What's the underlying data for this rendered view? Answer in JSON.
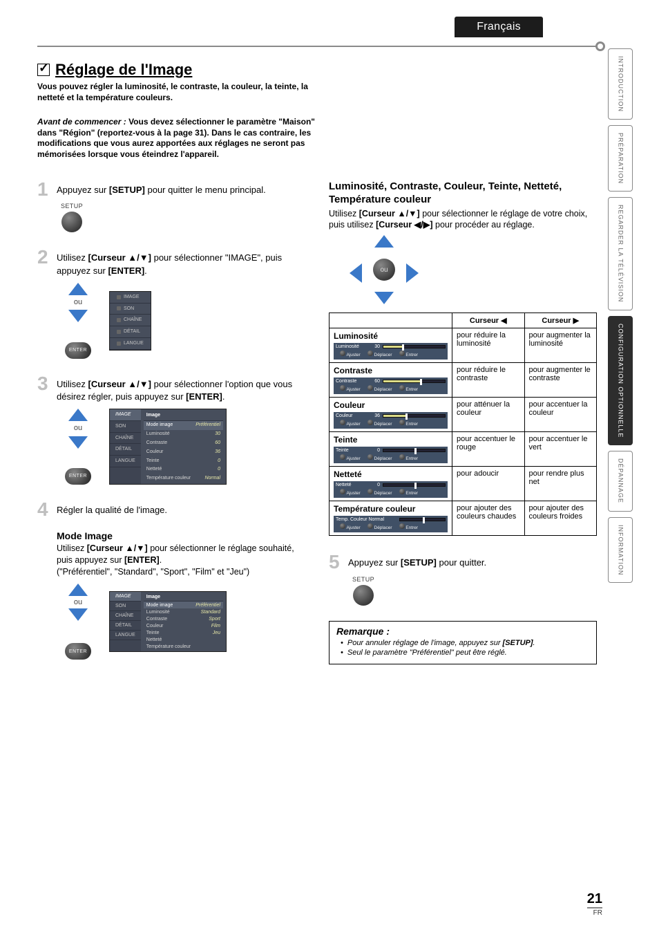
{
  "language_tab": "Français",
  "sidebar_tabs": [
    {
      "label": "INTRODUCTION",
      "active": false
    },
    {
      "label": "PRÉPARATION",
      "active": false
    },
    {
      "label": "REGARDER LA\nTÉLÉVISION",
      "active": false
    },
    {
      "label": "CONFIGURATION\nOPTIONNELLE",
      "active": true
    },
    {
      "label": "DÉPANNAGE",
      "active": false
    },
    {
      "label": "INFORMATION",
      "active": false
    }
  ],
  "title": "Réglage de l'Image",
  "intro": "Vous pouvez régler la luminosité, le contraste, la couleur, la teinte, la netteté et la température couleurs.",
  "before_label": "Avant de commencer :",
  "before_body": "Vous devez sélectionner le paramètre \"Maison\" dans \"Région\" (reportez-vous à la page 31). Dans le cas contraire, les modifications que vous aurez apportées aux réglages ne seront pas mémorisées lorsque vous éteindrez l'appareil.",
  "steps": {
    "s1": {
      "num": "1",
      "text_pre": "Appuyez sur ",
      "bold": "[SETUP]",
      "text_post": " pour quitter le menu principal.",
      "btn_label": "SETUP"
    },
    "s2": {
      "num": "2",
      "text1": "Utilisez ",
      "bold1": "[Curseur ▲/▼]",
      "text2": " pour sélectionner \"IMAGE\", puis appuyez sur ",
      "bold2": "[ENTER]",
      "text3": ".",
      "or": "ou",
      "enter": "ENTER",
      "menu_items": [
        "IMAGE",
        "SON",
        "CHAÎNE",
        "DÉTAIL",
        "LANGUE"
      ]
    },
    "s3": {
      "num": "3",
      "text1": "Utilisez ",
      "bold1": "[Curseur ▲/▼]",
      "text2": " pour sélectionner l'option que vous désirez régler, puis appuyez sur ",
      "bold2": "[ENTER]",
      "text3": ".",
      "or": "ou",
      "enter": "ENTER",
      "osd_title": "Image",
      "osd_side": [
        "IMAGE",
        "SON",
        "CHAÎNE",
        "DÉTAIL",
        "LANGUE"
      ],
      "osd_rows": [
        {
          "k": "Mode image",
          "v": "Préférentiel",
          "sel": true
        },
        {
          "k": "Luminosité",
          "v": "30"
        },
        {
          "k": "Contraste",
          "v": "60"
        },
        {
          "k": "Couleur",
          "v": "36"
        },
        {
          "k": "Teinte",
          "v": "0"
        },
        {
          "k": "Netteté",
          "v": "0"
        },
        {
          "k": "Température couleur",
          "v": "Normal"
        }
      ]
    },
    "s4": {
      "num": "4",
      "text": "Régler la qualité de l'image."
    },
    "s5": {
      "num": "5",
      "text_pre": "Appuyez sur ",
      "bold": "[SETUP]",
      "text_post": " pour quitter.",
      "btn_label": "SETUP"
    }
  },
  "mode_image": {
    "title": "Mode Image",
    "text1": "Utilisez ",
    "bold1": "[Curseur ▲/▼]",
    "text2": " pour sélectionner le réglage souhaité, puis appuyez sur ",
    "bold2": "[ENTER]",
    "text3": ".",
    "options_note": "(\"Préférentiel\", \"Standard\", \"Sport\", \"Film\" et \"Jeu\")",
    "or": "ou",
    "enter": "ENTER",
    "osd_title": "Image",
    "osd_side": [
      "IMAGE",
      "SON",
      "CHAÎNE",
      "DÉTAIL",
      "LANGUE"
    ],
    "osd_left": [
      "Mode image",
      "Luminosité",
      "Contraste",
      "Couleur",
      "Teinte",
      "Netteté",
      "Température couleur"
    ],
    "osd_right": [
      "Préférentiel",
      "Standard",
      "Sport",
      "Film",
      "Jeu"
    ]
  },
  "r_section": {
    "title": "Luminosité, Contraste, Couleur, Teinte, Netteté, Température couleur",
    "text1": "Utilisez ",
    "bold1": "[Curseur ▲/▼]",
    "text2": " pour sélectionner le réglage de votre choix, puis utilisez ",
    "bold2": "[Curseur ◀/▶]",
    "text3": " pour procéder au réglage.",
    "or": "ou"
  },
  "table": {
    "head_left": "Curseur ◀",
    "head_right": "Curseur ▶",
    "bar_labels": {
      "adjust": "Ajuster",
      "move": "Déplacer",
      "enter": "Entrer"
    },
    "rows": [
      {
        "name": "Luminosité",
        "bar_label": "Luminosité",
        "bar_val": "30",
        "fill": 30,
        "tick": 30,
        "left": "pour réduire la luminosité",
        "right": "pour augmenter la luminosité"
      },
      {
        "name": "Contraste",
        "bar_label": "Contraste",
        "bar_val": "60",
        "fill": 60,
        "tick": 60,
        "pattern": true,
        "left": "pour réduire le contraste",
        "right": "pour augmenter le contraste"
      },
      {
        "name": "Couleur",
        "bar_label": "Couleur",
        "bar_val": "36",
        "fill": 36,
        "tick": 36,
        "left": "pour atténuer la couleur",
        "right": "pour accentuer la couleur"
      },
      {
        "name": "Teinte",
        "bar_label": "Teinte",
        "bar_val": "0",
        "fill": 0,
        "tick": 50,
        "left": "pour accentuer le rouge",
        "right": "pour accentuer le vert"
      },
      {
        "name": "Netteté",
        "bar_label": "Netteté",
        "bar_val": "0",
        "fill": 0,
        "tick": 50,
        "pattern": true,
        "left": "pour adoucir",
        "right": "pour rendre plus net"
      },
      {
        "name": "Température couleur",
        "bar_label": "Temp. Couleur Normal",
        "bar_val": "",
        "fill": 0,
        "tick": 50,
        "left": "pour ajouter des couleurs chaudes",
        "right": "pour ajouter des couleurs froides"
      }
    ]
  },
  "note": {
    "title": "Remarque :",
    "items": [
      {
        "pre": "Pour annuler réglage de l'image, appuyez sur ",
        "bold": "[SETUP]",
        "post": "."
      },
      {
        "pre": "Seul le paramètre \"Préférentiel\" peut être réglé.",
        "bold": "",
        "post": ""
      }
    ]
  },
  "page_number": "21",
  "page_locale": "FR"
}
